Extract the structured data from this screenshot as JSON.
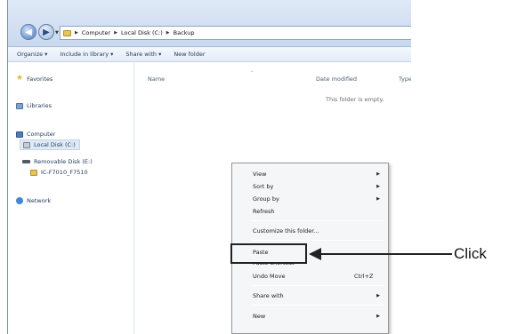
{
  "address_bar": {
    "crumbs": [
      "Computer",
      "Local Disk (C:)",
      "Backup"
    ]
  },
  "toolbar": {
    "organize": "Organize ▾",
    "include_in_library": "Include in library ▾",
    "share_with": "Share with ▾",
    "new_folder": "New folder"
  },
  "nav_pane": {
    "favorites": "Favorites",
    "libraries": "Libraries",
    "computer": "Computer",
    "local_disk": "Local Disk (C:)",
    "removable_disk": "Removable Disk (E:)",
    "ic_folder": "IC-F7010_F7510",
    "network": "Network"
  },
  "columns": {
    "name": "Name",
    "date_modified": "Date modified",
    "type": "Type"
  },
  "empty_message": "This folder is empty.",
  "context_menu": {
    "view": "View",
    "sort_by": "Sort by",
    "group_by": "Group by",
    "refresh": "Refresh",
    "customize": "Customize this folder...",
    "paste": "Paste",
    "paste_shortcut": "Paste shortcut",
    "undo_move": "Undo Move",
    "undo_shortcut": "Ctrl+Z",
    "share_with": "Share with",
    "new": "New"
  },
  "annotation": {
    "label": "Click"
  },
  "icons": {
    "back": "back-arrow-icon",
    "forward": "forward-arrow-icon",
    "submenu": "chevron-right-icon"
  }
}
